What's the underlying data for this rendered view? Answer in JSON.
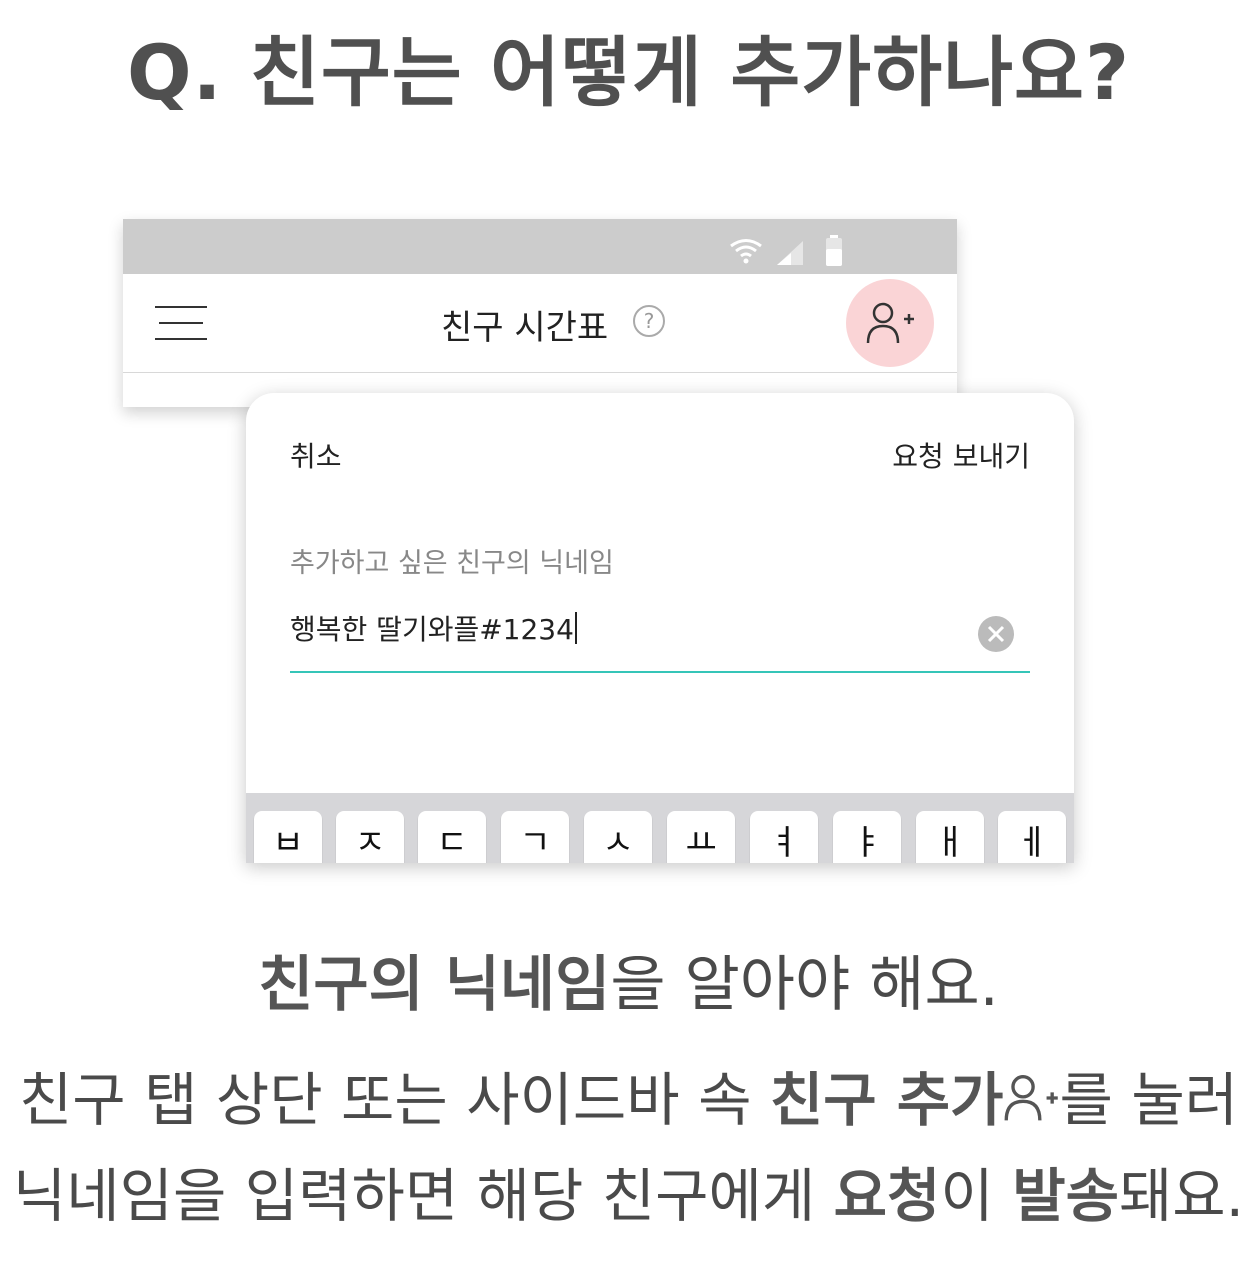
{
  "headline": "Q. 친구는 어떻게 추가하나요?",
  "appbar": {
    "title": "친구 시간표",
    "help_icon": "?",
    "add_friend_icon": "person-plus-icon"
  },
  "sheet": {
    "cancel_label": "취소",
    "send_label": "요청 보내기",
    "field_label": "추가하고 싶은 친구의 닉네임",
    "field_value": "행복한 딸기와플#1234"
  },
  "keyboard": {
    "keys": [
      "ㅂ",
      "ㅈ",
      "ㄷ",
      "ㄱ",
      "ㅅ",
      "ㅛ",
      "ㅕ",
      "ㅑ",
      "ㅐ",
      "ㅔ"
    ]
  },
  "caption": {
    "line1_bold": "친구의 닉네임",
    "line1_rest": "을 알아야 해요.",
    "line2_a": "친구 탭 상단 또는 사이드바 속 ",
    "line2_bold": "친구 추가",
    "line2_b": "를 눌러",
    "line3_a": "닉네임을 입력하면 해당 친구에게 ",
    "line3_bold1": "요청",
    "line3_b": "이 ",
    "line3_bold2": "발송",
    "line3_c": "돼요."
  },
  "colors": {
    "accent_teal": "#35c5b8",
    "add_button_bg": "#fad4d6",
    "status_bar": "#cccccc"
  }
}
